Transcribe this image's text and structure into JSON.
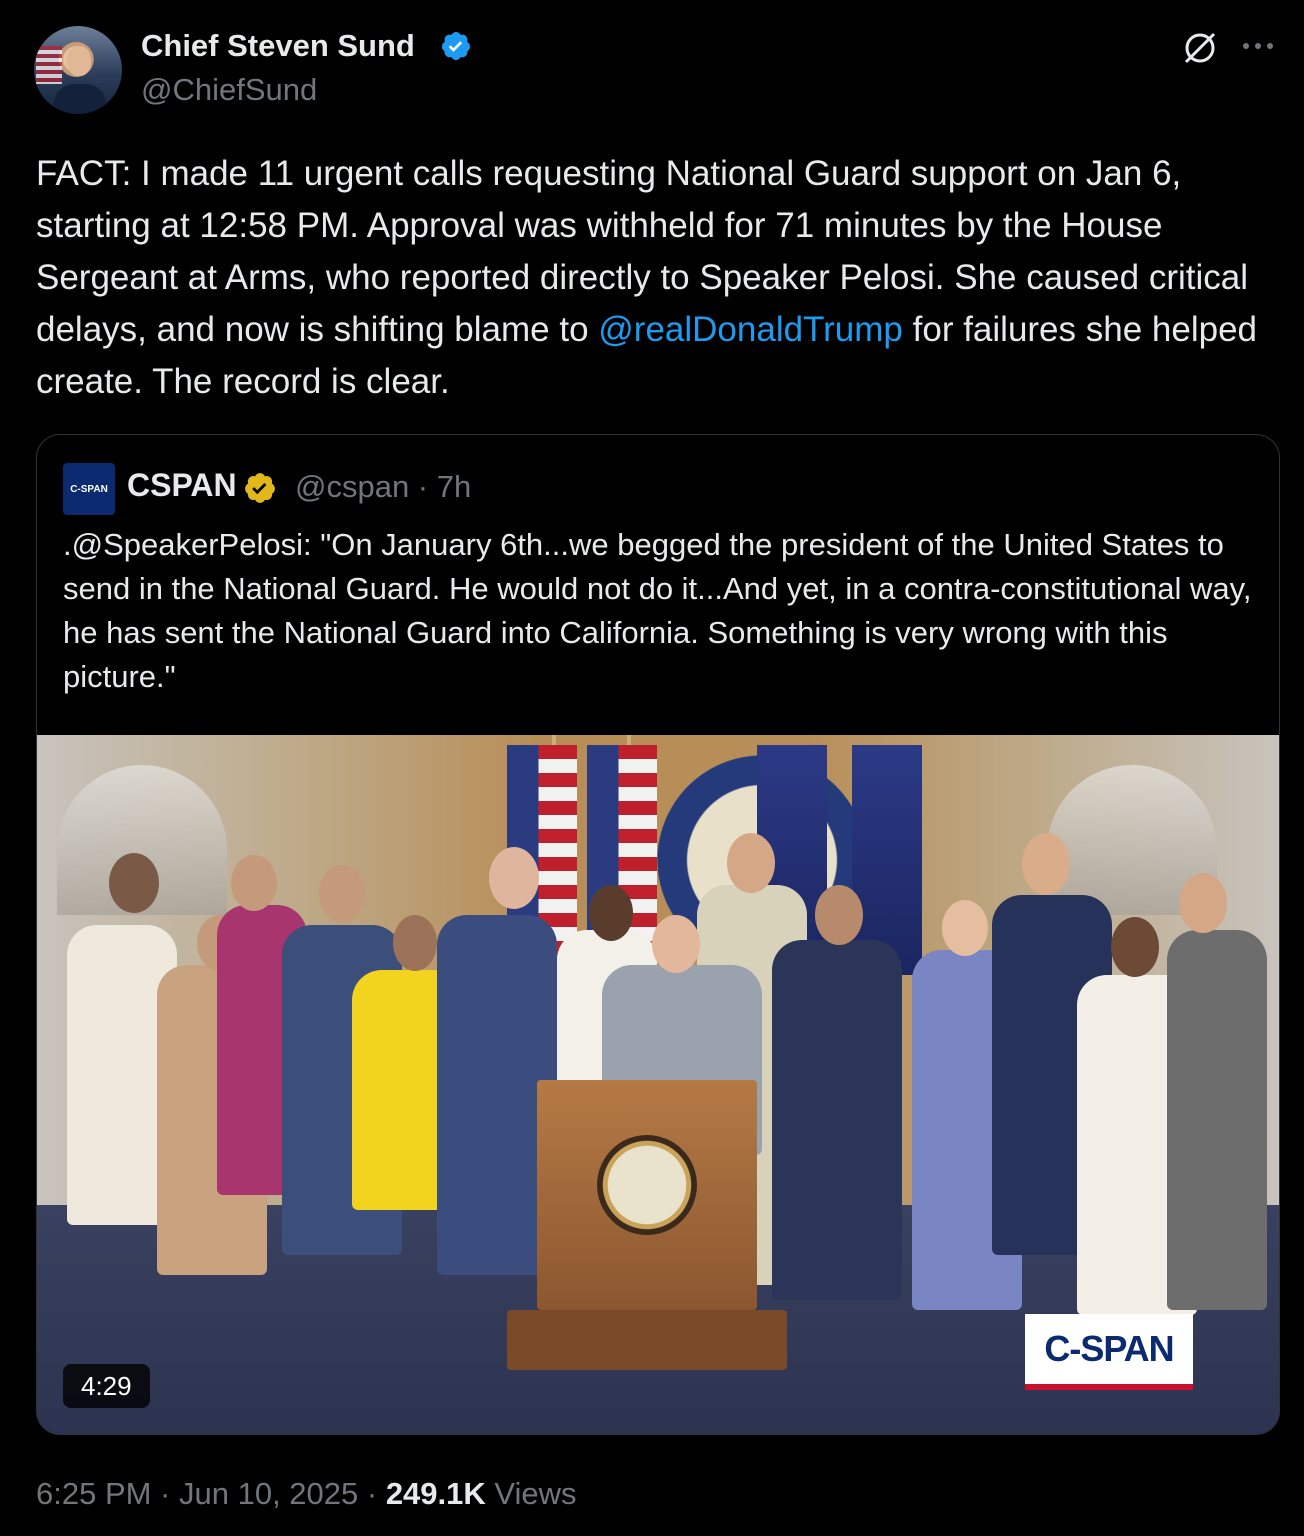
{
  "tweet": {
    "author_name": "Chief Steven Sund",
    "handle": "@ChiefSund",
    "text_before_mention": "FACT: I made 11 urgent calls requesting National Guard support on Jan 6, starting at 12:58 PM. Approval was withheld for 71 minutes by the House Sergeant at Arms, who reported directly to Speaker Pelosi. She caused critical delays, and now is shifting blame to ",
    "mention": "@realDonaldTrump",
    "text_after_mention": " for failures she helped create. The record is clear."
  },
  "quote": {
    "avatar_text": "C-SPAN",
    "name": "CSPAN",
    "meta": "@cspan · 7h",
    "text": ".@SpeakerPelosi: \"On January 6th...we begged the president of the United States to send in the National Guard. He would not do it...And yet, in a contra-constitutional way, he has sent the National Guard into California. Something is very wrong with this picture.\"",
    "video": {
      "duration": "4:29",
      "watermark": "C-SPAN"
    }
  },
  "footer": {
    "time_date": "6:25 PM · Jun 10, 2025 · ",
    "views_count": "249.1K",
    "views_label": " Views"
  },
  "colors": {
    "background": "#000000",
    "link": "#1d9bf0",
    "verified_blue": "#1d9bf0",
    "verified_gold": "#e2b719",
    "secondary_text": "#71767b"
  }
}
